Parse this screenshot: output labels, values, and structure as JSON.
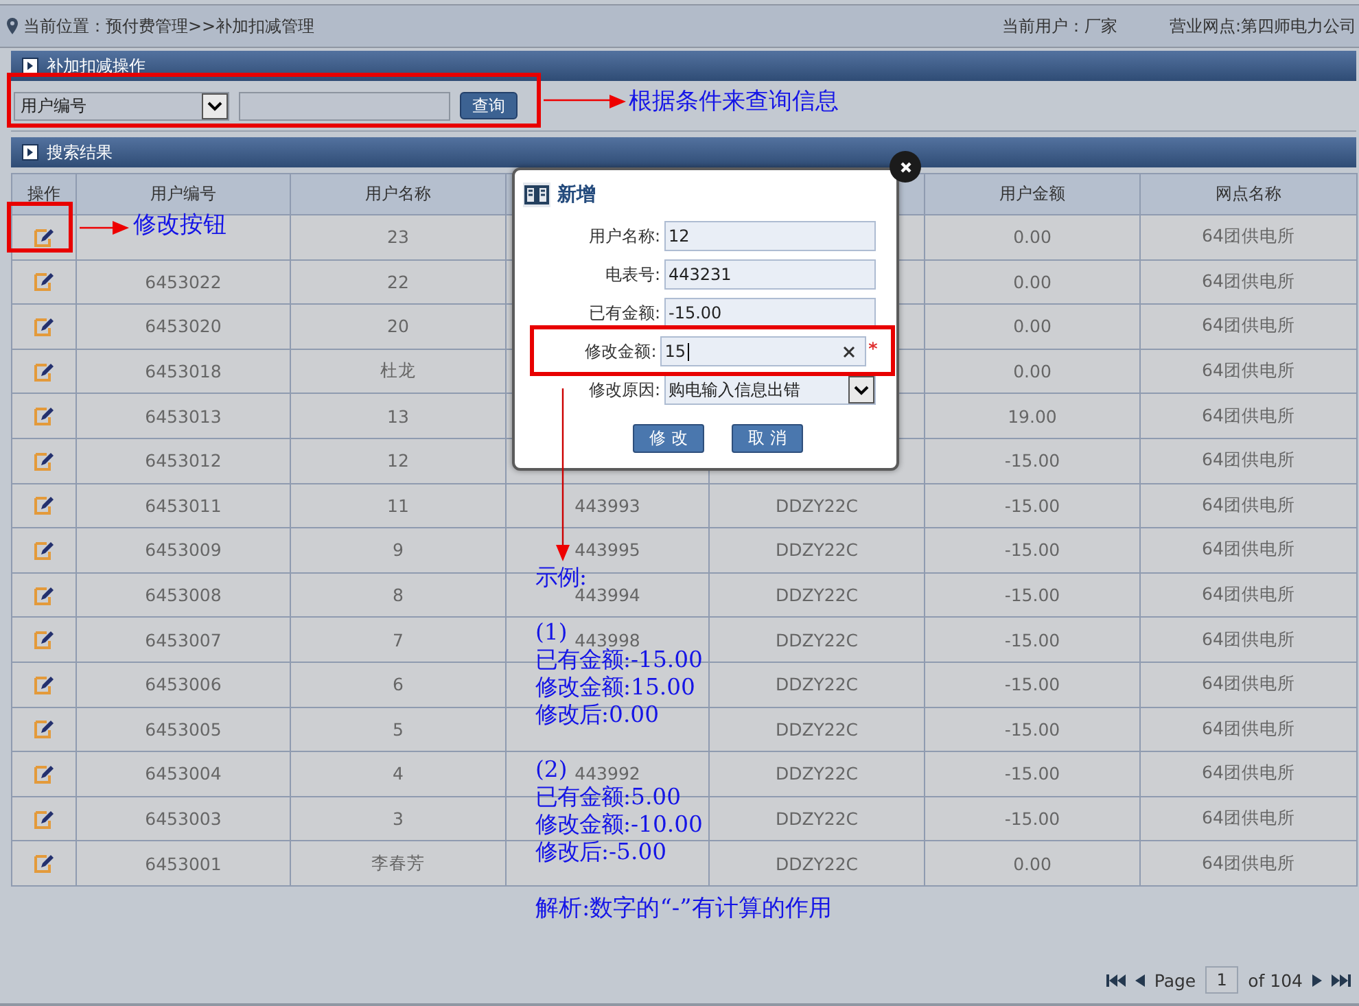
{
  "header": {
    "location": "当前位置：预付费管理>>补加扣减管理",
    "current_user": "当前用户：厂家",
    "branch": "营业网点:第四师电力公司"
  },
  "search_panel": {
    "title": "补加扣减操作",
    "field_select": "用户编号",
    "query_button": "查询"
  },
  "results_panel": {
    "title": "搜索结果",
    "columns": [
      {
        "label": "操作"
      },
      {
        "label": "用户编号"
      },
      {
        "label": "用户名称"
      },
      {},
      {},
      {
        "label": "用户金额"
      },
      {
        "label": "网点名称"
      }
    ],
    "rows": [
      {
        "name": "23",
        "amount": "0.00",
        "site": "64团供电所"
      },
      {
        "id": "6453022",
        "name": "22",
        "amount": "0.00",
        "site": "64团供电所"
      },
      {
        "id": "6453020",
        "name": "20",
        "amount": "0.00",
        "site": "64团供电所"
      },
      {
        "id": "6453018",
        "name": "杜龙",
        "amount": "0.00",
        "site": "64团供电所"
      },
      {
        "id": "6453013",
        "name": "13",
        "amount": "19.00",
        "site": "64团供电所"
      },
      {
        "id": "6453012",
        "name": "12",
        "amount": "-15.00",
        "site": "64团供电所"
      },
      {
        "id": "6453011",
        "name": "11",
        "meter": "443993",
        "model": "DDZY22C",
        "amount": "-15.00",
        "site": "64团供电所"
      },
      {
        "id": "6453009",
        "name": "9",
        "meter": "443995",
        "model": "DDZY22C",
        "amount": "-15.00",
        "site": "64团供电所"
      },
      {
        "id": "6453008",
        "name": "8",
        "meter": "443994",
        "model": "DDZY22C",
        "amount": "-15.00",
        "site": "64团供电所"
      },
      {
        "id": "6453007",
        "name": "7",
        "meter": "443998",
        "model": "DDZY22C",
        "amount": "-15.00",
        "site": "64团供电所"
      },
      {
        "id": "6453006",
        "name": "6",
        "model": "DDZY22C",
        "amount": "-15.00",
        "site": "64团供电所"
      },
      {
        "id": "6453005",
        "name": "5",
        "model": "DDZY22C",
        "amount": "-15.00",
        "site": "64团供电所"
      },
      {
        "id": "6453004",
        "name": "4",
        "meter": "443992",
        "model": "DDZY22C",
        "amount": "-15.00",
        "site": "64团供电所"
      },
      {
        "id": "6453003",
        "name": "3",
        "model": "DDZY22C",
        "amount": "-15.00",
        "site": "64团供电所"
      },
      {
        "id": "6453001",
        "name": "李春芳",
        "model": "DDZY22C",
        "amount": "0.00",
        "site": "64团供电所"
      }
    ],
    "pagination": {
      "page_label": "Page",
      "page": "1",
      "total": "of 104"
    }
  },
  "dialog": {
    "title": "新增",
    "fields": [
      {
        "kind": "text",
        "label": "用户名称:",
        "value": "12"
      },
      {
        "kind": "text",
        "label": "电表号:",
        "value": "443231"
      },
      {
        "kind": "text",
        "label": "已有金额:",
        "value": "-15.00"
      },
      {
        "kind": "clearable",
        "label": "修改金额:",
        "value": "15",
        "required": true
      },
      {
        "kind": "select",
        "label": "修改原因:",
        "value": "购电输入信息出错"
      }
    ],
    "buttons": [
      "修 改",
      "取 消"
    ]
  },
  "annotations": {
    "search_note": "根据条件来查询信息",
    "edit_note": "修改按钮",
    "example_title": "示例:",
    "cases": [
      {
        "label": "(1)",
        "lines": [
          "已有金额:-15.00",
          "修改金额:15.00",
          "修改后:0.00"
        ]
      },
      {
        "label": "(2)",
        "lines": [
          "已有金额:5.00",
          "修改金额:-10.00",
          "修改后:-5.00"
        ]
      }
    ],
    "explanation": "解析:数字的“-”有计算的作用"
  }
}
